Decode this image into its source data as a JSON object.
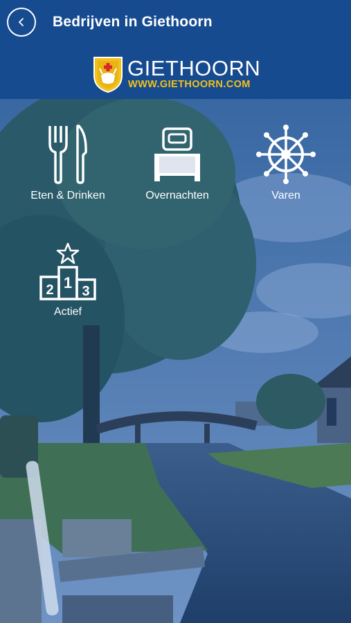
{
  "header": {
    "title": "Bedrijven in Giethoorn",
    "back_icon": "chevron-left-icon"
  },
  "logo": {
    "name": "GIETHOORN",
    "url": "WWW.GIETHOORN.COM",
    "shield_color": "#f2c21a"
  },
  "categories": [
    {
      "label": "Eten & Drinken",
      "icon": "fork-knife-icon"
    },
    {
      "label": "Overnachten",
      "icon": "bed-icon"
    },
    {
      "label": "Varen",
      "icon": "ship-wheel-icon"
    },
    {
      "label": "Actief",
      "icon": "podium-star-icon"
    }
  ],
  "colors": {
    "header_bg": "#164b90",
    "text": "#ffffff",
    "accent": "#f2c21a"
  }
}
